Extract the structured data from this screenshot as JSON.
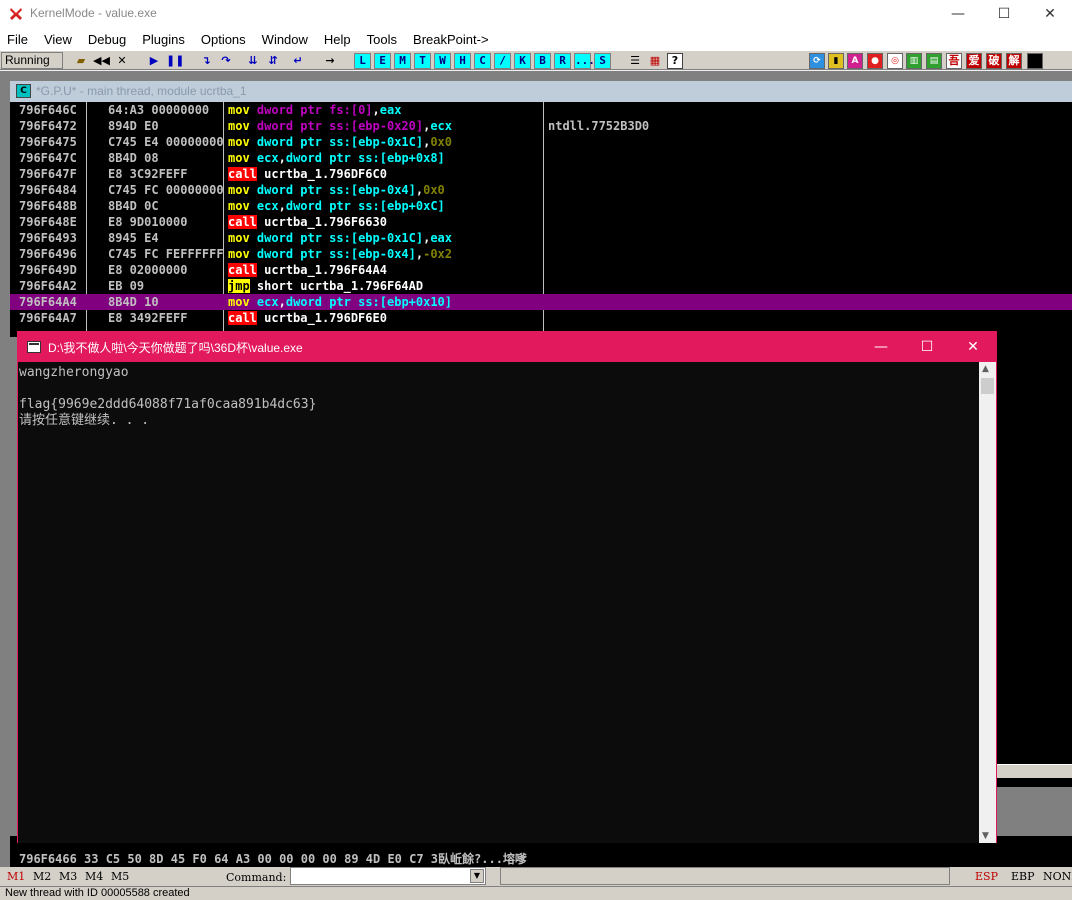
{
  "window": {
    "title": "KernelMode - value.exe",
    "minimize": "—",
    "maximize": "☐",
    "close": "✕"
  },
  "menu": [
    "File",
    "View",
    "Debug",
    "Plugins",
    "Options",
    "Window",
    "Help",
    "Tools",
    "BreakPoint->"
  ],
  "toolbar": {
    "status": "Running",
    "letter_buttons": [
      "L",
      "E",
      "M",
      "T",
      "W",
      "H",
      "C",
      "/",
      "K",
      "B",
      "R",
      "...",
      "S"
    ],
    "right_icons": [
      "吾",
      "爱",
      "破",
      "解"
    ]
  },
  "cpu_window": {
    "title": "*G.P.U* - main thread, module ucrtba_1",
    "icon_label": "C"
  },
  "disasm": [
    {
      "addr": "796F646C",
      "hex": "64:A3 00000000",
      "op": "mov",
      "args": [
        [
          "kw",
          "dword ptr "
        ],
        [
          "kw",
          "fs:[0]"
        ],
        [
          "w",
          ","
        ],
        [
          "reg",
          "eax"
        ]
      ],
      "comment": ""
    },
    {
      "addr": "796F6472",
      "hex": "894D E0",
      "op": "mov",
      "args": [
        [
          "kw",
          "dword ptr "
        ],
        [
          "kw",
          "ss:[ebp-0x20]"
        ],
        [
          "w",
          ","
        ],
        [
          "reg",
          "ecx"
        ]
      ],
      "comment": "ntdll.7752B3D0"
    },
    {
      "addr": "796F6475",
      "hex": "C745 E4 00000000",
      "op": "mov",
      "args": [
        [
          "reg",
          "dword ptr ss:[ebp-0x1C]"
        ],
        [
          "w",
          ","
        ],
        [
          "num",
          "0x0"
        ]
      ],
      "comment": ""
    },
    {
      "addr": "796F647C",
      "hex": "8B4D 08",
      "op": "mov",
      "args": [
        [
          "reg",
          "ecx"
        ],
        [
          "w",
          ","
        ],
        [
          "reg",
          "dword ptr ss:[ebp+0x8]"
        ]
      ],
      "comment": ""
    },
    {
      "addr": "796F647F",
      "hex": "E8 3C92FEFF",
      "op": "call",
      "args": [
        [
          "w",
          "ucrtba_1.796DF6C0"
        ]
      ],
      "comment": ""
    },
    {
      "addr": "796F6484",
      "hex": "C745 FC 00000000",
      "op": "mov",
      "args": [
        [
          "reg",
          "dword ptr ss:[ebp-0x4]"
        ],
        [
          "w",
          ","
        ],
        [
          "num",
          "0x0"
        ]
      ],
      "comment": ""
    },
    {
      "addr": "796F648B",
      "hex": "8B4D 0C",
      "op": "mov",
      "args": [
        [
          "reg",
          "ecx"
        ],
        [
          "w",
          ","
        ],
        [
          "reg",
          "dword ptr ss:[ebp+0xC]"
        ]
      ],
      "comment": ""
    },
    {
      "addr": "796F648E",
      "hex": "E8 9D010000",
      "op": "call",
      "args": [
        [
          "w",
          "ucrtba_1.796F6630"
        ]
      ],
      "comment": ""
    },
    {
      "addr": "796F6493",
      "hex": "8945 E4",
      "op": "mov",
      "args": [
        [
          "reg",
          "dword ptr ss:[ebp-0x1C]"
        ],
        [
          "w",
          ","
        ],
        [
          "reg",
          "eax"
        ]
      ],
      "comment": ""
    },
    {
      "addr": "796F6496",
      "hex": "C745 FC FEFFFFFF",
      "op": "mov",
      "args": [
        [
          "reg",
          "dword ptr ss:[ebp-0x4]"
        ],
        [
          "w",
          ","
        ],
        [
          "num",
          "-0x2"
        ]
      ],
      "comment": ""
    },
    {
      "addr": "796F649D",
      "hex": "E8 02000000",
      "op": "call",
      "args": [
        [
          "w",
          "ucrtba_1.796F64A4"
        ]
      ],
      "comment": ""
    },
    {
      "addr": "796F64A2",
      "hex": "EB 09",
      "op": "jmp",
      "args": [
        [
          "w",
          "short ucrtba_1.796F64AD"
        ]
      ],
      "comment": ""
    },
    {
      "addr": "796F64A4",
      "hex": "8B4D 10",
      "op": "mov",
      "args": [
        [
          "reg",
          "ecx"
        ],
        [
          "w",
          ","
        ],
        [
          "reg",
          "dword ptr ss:[ebp+0x10]"
        ]
      ],
      "comment": "",
      "selected": true
    },
    {
      "addr": "796F64A7",
      "hex": "E8 3492FEFF",
      "op": "call",
      "args": [
        [
          "w",
          "ucrtba_1.796DF6E0"
        ]
      ],
      "comment": ""
    }
  ],
  "dump": {
    "row1": "796F6466 33 C5 50 8D 45 F0 64 A3 00 00 00 00 89 4D E0 C7 3臥岴餘?...塎嗲"
  },
  "console": {
    "title": "D:\\我不做人啦\\今天你做题了吗\\36D杯\\value.exe",
    "lines": [
      "wangzherongyao",
      "",
      "flag{9969e2ddd64088f71af0caa891b4dc63}",
      "请按任意键继续. . ."
    ]
  },
  "cmdbar": {
    "tabs": [
      "M1",
      "M2",
      "M3",
      "M4",
      "M5"
    ],
    "command_label": "Command:",
    "command_value": "",
    "regs": [
      "ESP",
      "EBP",
      "NONE"
    ]
  },
  "status": "New thread with ID 00005588 created",
  "colors": {
    "console_title": "#e3195d",
    "selected_row": "#800080",
    "call_bg": "#ff0000",
    "mov_fg": "#ffff00"
  }
}
